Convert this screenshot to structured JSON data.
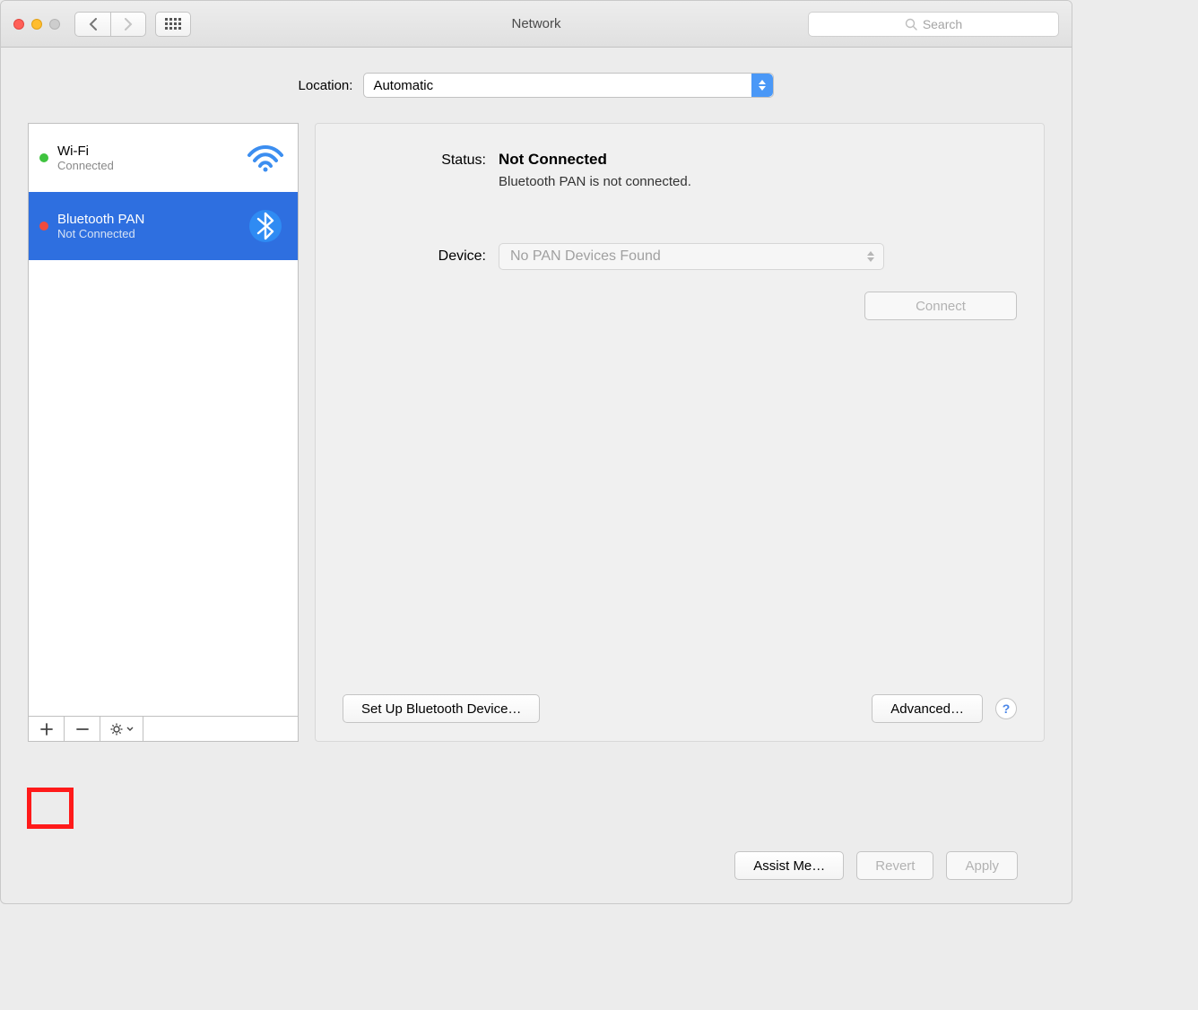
{
  "window": {
    "title": "Network"
  },
  "search": {
    "placeholder": "Search"
  },
  "location": {
    "label": "Location:",
    "value": "Automatic"
  },
  "services": [
    {
      "name": "Wi-Fi",
      "status": "Connected",
      "dot": "green",
      "icon": "wifi",
      "selected": false
    },
    {
      "name": "Bluetooth PAN",
      "status": "Not Connected",
      "dot": "red",
      "icon": "bluetooth",
      "selected": true
    }
  ],
  "detail": {
    "status_label": "Status:",
    "status_value": "Not Connected",
    "status_msg": "Bluetooth PAN is not connected.",
    "device_label": "Device:",
    "device_value": "No PAN Devices Found",
    "connect": "Connect",
    "setup": "Set Up Bluetooth Device…",
    "advanced": "Advanced…"
  },
  "footer": {
    "assist": "Assist Me…",
    "revert": "Revert",
    "apply": "Apply"
  }
}
